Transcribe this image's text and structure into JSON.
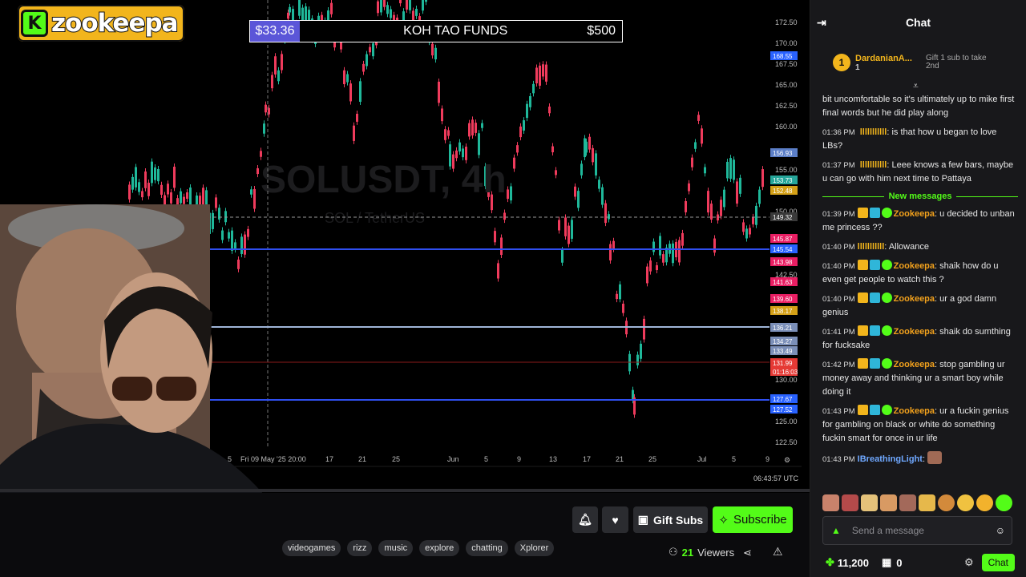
{
  "logo": {
    "k": "K",
    "name": "zookeepa"
  },
  "funds": {
    "current": "$33.36",
    "title": "KOH TAO FUNDS",
    "goal": "$500"
  },
  "chart": {
    "watermark_symbol": "SOLUSDT, 4h",
    "watermark_pair": "SOL / TetherUS",
    "time_labels": [
      "5",
      "Fri 09 May '25  20:00",
      "17",
      "21",
      "25",
      "Jun",
      "5",
      "9",
      "13",
      "17",
      "21",
      "25",
      "Jul",
      "5",
      "9"
    ],
    "price_ticks": [
      "172.50",
      "170.00",
      "167.50",
      "165.00",
      "162.50",
      "160.00",
      "155.00",
      "150.00",
      "142.50",
      "130.00",
      "125.00",
      "122.50"
    ],
    "price_tags": [
      {
        "label": "168.55",
        "color": "#2962ff"
      },
      {
        "label": "156.93",
        "color": "#5b7ec7"
      },
      {
        "label": "153.73",
        "color": "#26a69a"
      },
      {
        "label": "152.48",
        "color": "#d4a017"
      },
      {
        "label": "149.32",
        "color": "#3a3a3a"
      },
      {
        "label": "145.87",
        "color": "#e91e63"
      },
      {
        "label": "145.54",
        "color": "#2962ff"
      },
      {
        "label": "143.98",
        "color": "#e91e63"
      },
      {
        "label": "141.63",
        "color": "#e91e63"
      },
      {
        "label": "139.60",
        "color": "#e91e63"
      },
      {
        "label": "138.17",
        "color": "#d4a017"
      },
      {
        "label": "136.21",
        "color": "#7b8fb8"
      },
      {
        "label": "134.27",
        "color": "#7b8fb8"
      },
      {
        "label": "133.49",
        "color": "#7b8fb8"
      },
      {
        "label": "131.99",
        "color": "#e53935"
      },
      {
        "label": "01:16:03",
        "color": "#e53935"
      },
      {
        "label": "127.67",
        "color": "#2962ff"
      },
      {
        "label": "127.52",
        "color": "#2962ff"
      }
    ]
  },
  "utc_time": "06:43:57 UTC",
  "actions": {
    "gift_subs": "Gift Subs",
    "subscribe": "Subscribe"
  },
  "tags": [
    "videogames",
    "rizz",
    "music",
    "explore",
    "chatting",
    "Xplorer"
  ],
  "viewers": {
    "count": "21",
    "label": "Viewers"
  },
  "chat": {
    "title": "Chat",
    "pinned": {
      "rank": "1",
      "user": "DardanianA...",
      "count": "1",
      "gift_text": "Gift 1 sub to take 2nd"
    },
    "messages_before": [
      {
        "time": "",
        "user": "",
        "text": "bit uncomfortable so it's ultimately up to mike first final words but he did play along"
      },
      {
        "time": "01:36 PM",
        "user": "lllllllllll",
        "text": "is that how u began to love LBs?"
      },
      {
        "time": "01:37 PM",
        "user": "lllllllllll",
        "text": "Leee knows a few bars, maybe u can go with him next time to Pattaya"
      }
    ],
    "new_messages_label": "New messages",
    "messages_after": [
      {
        "time": "01:39 PM",
        "user": "Zookeepa",
        "badges": true,
        "text": "u decided to unban me princess ??"
      },
      {
        "time": "01:40 PM",
        "user": "lllllllllll",
        "badges": false,
        "text": "Allowance"
      },
      {
        "time": "01:40 PM",
        "user": "Zookeepa",
        "badges": true,
        "text": "shaik how do u even get people to watch this ?"
      },
      {
        "time": "01:40 PM",
        "user": "Zookeepa",
        "badges": true,
        "text": "ur a god damn genius"
      },
      {
        "time": "01:41 PM",
        "user": "Zookeepa",
        "badges": true,
        "text": "shaik do sumthing for fucksake"
      },
      {
        "time": "01:42 PM",
        "user": "Zookeepa",
        "badges": true,
        "text": "stop gambling ur money away and thinking ur a smart boy while doing it"
      },
      {
        "time": "01:43 PM",
        "user": "Zookeepa",
        "badges": true,
        "text": "ur a fuckin genius for gambling on black or white do something fuckin smart for once in ur life"
      },
      {
        "time": "01:43 PM",
        "user": "IBreathingLight",
        "badges": false,
        "text": ""
      }
    ],
    "input_placeholder": "Send a message",
    "points": "11,200",
    "drops": "0",
    "send_label": "Chat"
  }
}
